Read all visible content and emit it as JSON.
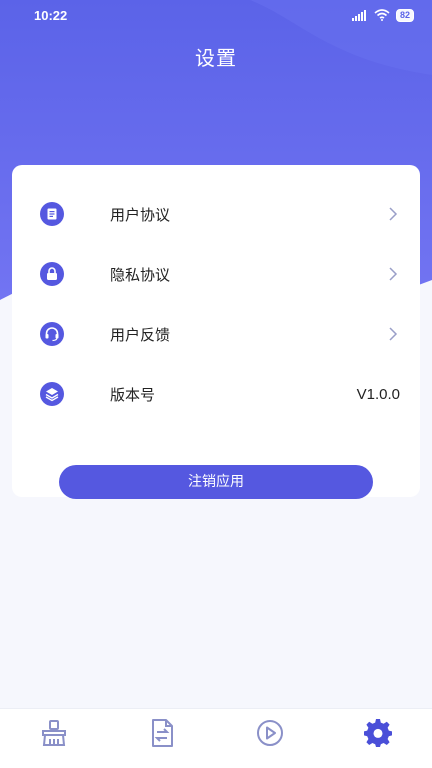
{
  "status_bar": {
    "time": "10:22",
    "battery": "82",
    "icons": [
      "signal-icon",
      "wifi-icon",
      "battery-icon"
    ]
  },
  "header": {
    "title": "设置"
  },
  "menu": {
    "items": [
      {
        "label": "用户协议",
        "icon": "document-icon",
        "has_chevron": true
      },
      {
        "label": "隐私协议",
        "icon": "lock-icon",
        "has_chevron": true
      },
      {
        "label": "用户反馈",
        "icon": "headset-icon",
        "has_chevron": true
      },
      {
        "label": "版本号",
        "icon": "layers-icon",
        "value": "V1.0.0"
      }
    ]
  },
  "logout_button": {
    "label": "注销应用"
  },
  "tabbar": {
    "tabs": [
      {
        "icon": "broom-icon",
        "active": false
      },
      {
        "icon": "file-convert-icon",
        "active": false
      },
      {
        "icon": "play-icon",
        "active": false
      },
      {
        "icon": "settings-gear-icon",
        "active": true
      }
    ]
  },
  "colors": {
    "accent": "#5558e0",
    "header_gradient_top": "#5b6ae8",
    "header_gradient_bottom": "#6f72f0",
    "tab_inactive": "#8a90c8",
    "tab_active": "#4a4fd8"
  }
}
